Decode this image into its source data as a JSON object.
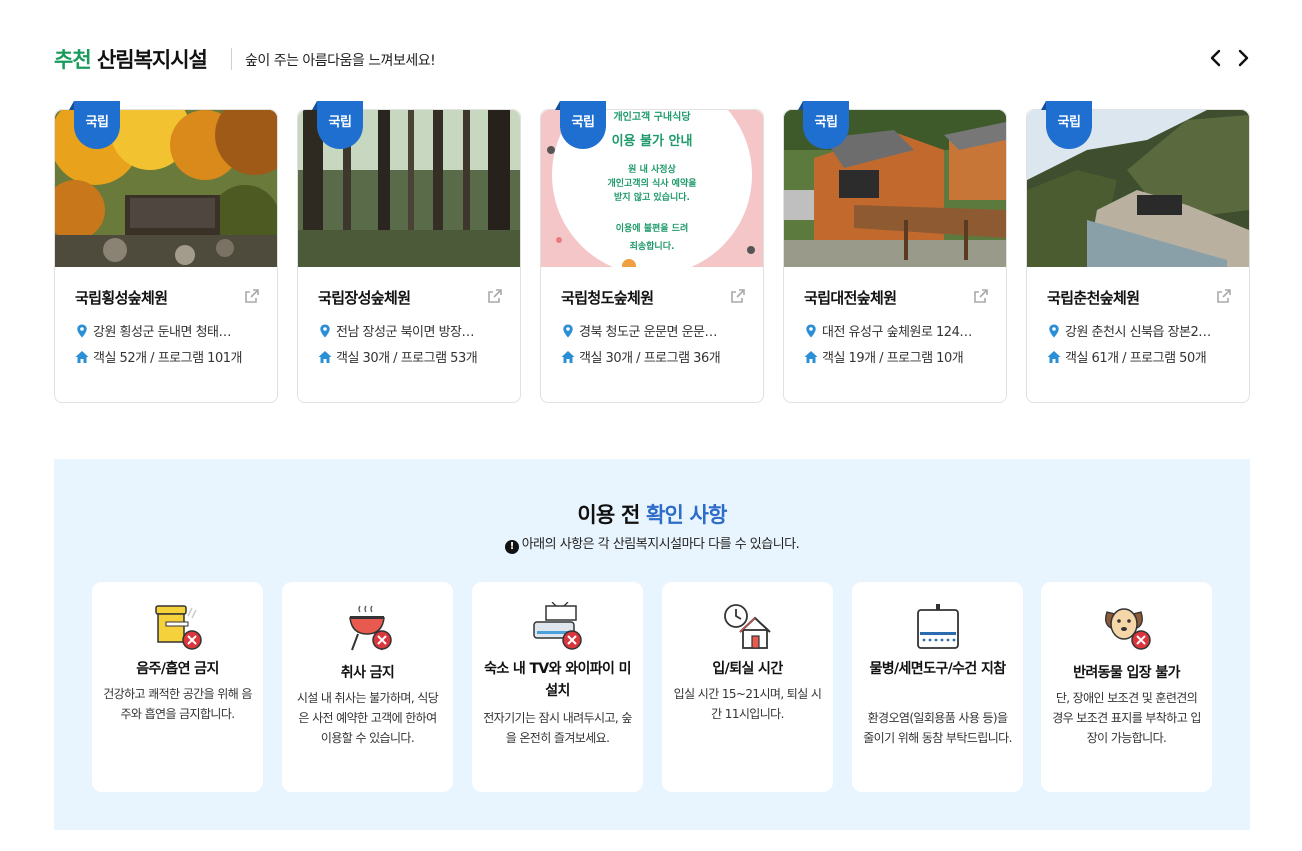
{
  "header": {
    "title_accent": "추천",
    "title_rest": "산림복지시설",
    "subtitle": "숲이 주는 아름다움을 느껴보세요!"
  },
  "cards": [
    {
      "badge": "국립",
      "name": "국립횡성숲체원",
      "address": "강원 횡성군 둔내면 청태…",
      "rooms": "객실 52개 / 프로그램 101개"
    },
    {
      "badge": "국립",
      "name": "국립장성숲체원",
      "address": "전남 장성군 북이면 방장…",
      "rooms": "객실 30개 / 프로그램 53개"
    },
    {
      "badge": "국립",
      "name": "국립청도숲체원",
      "address": "경북 청도군 운문면 운문…",
      "rooms": "객실 30개 / 프로그램 36개",
      "image_text": [
        "개인고객 구내식당",
        "이용 불가 안내",
        "원 내 사정상",
        "개인고객의 식사 예약을",
        "받지 않고 있습니다.",
        "이용에 불편을 드려",
        "죄송합니다."
      ]
    },
    {
      "badge": "국립",
      "name": "국립대전숲체원",
      "address": "대전 유성구 숲체원로 124…",
      "rooms": "객실 19개 / 프로그램 10개"
    },
    {
      "badge": "국립",
      "name": "국립춘천숲체원",
      "address": "강원 춘천시 신북읍 장본2…",
      "rooms": "객실 61개 / 프로그램 50개"
    }
  ],
  "info": {
    "title_main": "이용 전",
    "title_accent": "확인 사항",
    "notice_icon": "!",
    "notice": "아래의 사항은 각 산림복지시설마다 다를 수 있습니다.",
    "rules": [
      {
        "icon": "no-drinking-smoking-icon",
        "title": "음주/흡연 금지",
        "desc": "건강하고 쾌적한 공간을 위해 음주와 흡연을 금지합니다."
      },
      {
        "icon": "no-cooking-icon",
        "title": "취사 금지",
        "desc": "시설 내 취사는 불가하며, 식당은 사전 예약한 고객에 한하여 이용할 수 있습니다."
      },
      {
        "icon": "no-tv-wifi-icon",
        "title": "숙소 내 TV와 와이파이 미설치",
        "desc": "전자기기는 잠시 내려두시고, 숲을 온전히 즐겨보세요."
      },
      {
        "icon": "check-in-out-icon",
        "title": "입/퇴실 시간",
        "desc": "입실 시간 15~21시며, 퇴실 시간 11시입니다."
      },
      {
        "icon": "towel-icon",
        "title": "물병/세면도구/수건 지참",
        "desc": "환경오염(일회용품 사용 등)을 줄이기 위해 동참 부탁드립니다."
      },
      {
        "icon": "no-pets-icon",
        "title": "반려동물 입장 불가",
        "desc": "단, 장애인 보조견 및 훈련견의 경우 보조견 표지를 부착하고 입장이 가능합니다."
      }
    ]
  },
  "colors": {
    "accent_green": "#1a9a5b",
    "accent_blue": "#2d6cc9",
    "badge_blue": "#1f6fd1",
    "info_bg": "#e9f5fe",
    "icon_red": "#d9363e",
    "pin_blue": "#2b8fd6"
  }
}
